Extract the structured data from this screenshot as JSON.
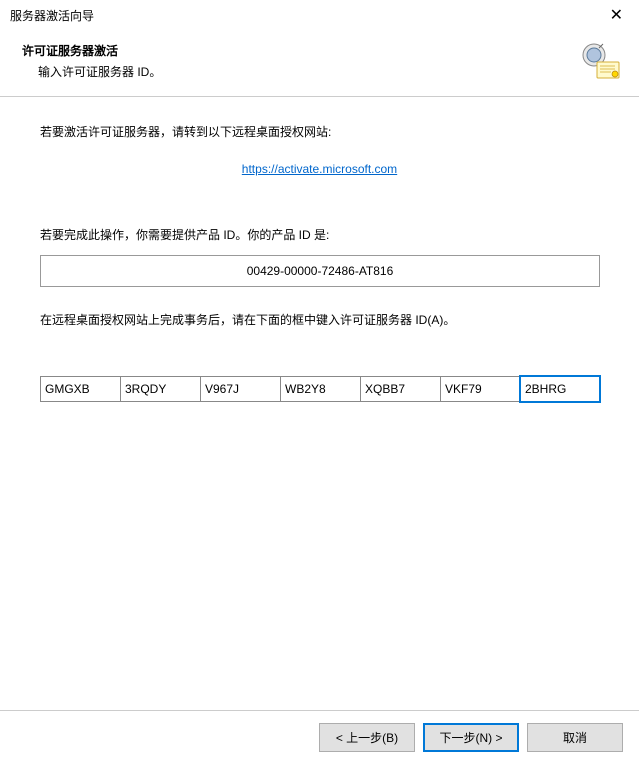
{
  "titlebar": {
    "title": "服务器激活向导"
  },
  "header": {
    "title": "许可证服务器激活",
    "subtitle": "输入许可证服务器 ID。"
  },
  "content": {
    "instruction1": "若要激活许可证服务器，请转到以下远程桌面授权网站:",
    "link_text": "https://activate.microsoft.com",
    "product_id_label": "若要完成此操作，你需要提供产品 ID。你的产品 ID 是:",
    "product_id_value": "00429-00000-72486-AT816",
    "server_id_label": "在远程桌面授权网站上完成事务后，请在下面的框中键入许可证服务器 ID(A)。",
    "id_segments": [
      "GMGXB",
      "3RQDY",
      "V967J",
      "WB2Y8",
      "XQBB7",
      "VKF79",
      "2BHRG"
    ]
  },
  "footer": {
    "back": "< 上一步(B)",
    "next": "下一步(N) >",
    "cancel": "取消"
  }
}
